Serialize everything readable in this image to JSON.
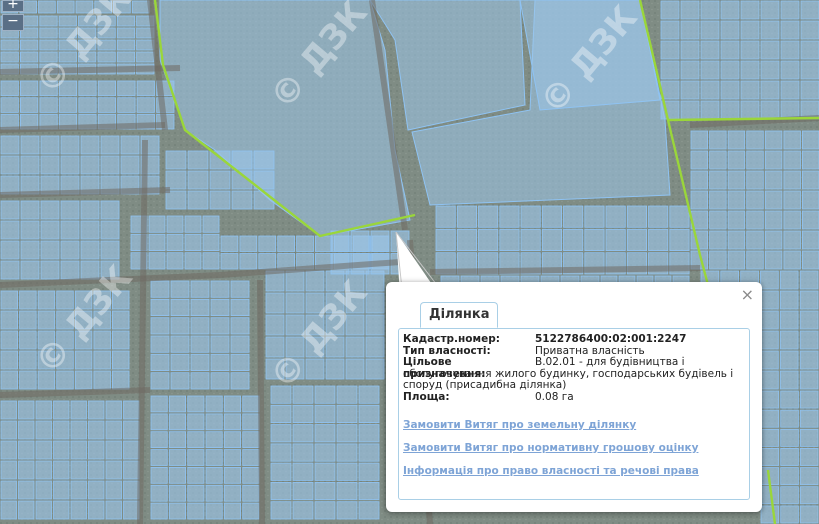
{
  "zoom": {
    "in_label": "+",
    "out_label": "−"
  },
  "watermark": {
    "text": "© ДЗК"
  },
  "colors": {
    "parcel_fill": "#9cc7ea",
    "parcel_stroke": "#8fc3f3",
    "boundary": "#9ad63a",
    "link": "#7ea4d6"
  },
  "popup": {
    "close_label": "×",
    "tab_label": "Ділянка",
    "fields": [
      {
        "label": "Кадастр.номер:",
        "value": "5122786400:02:001:2247"
      },
      {
        "label": "Тип власності:",
        "value": "Приватна власність"
      },
      {
        "label": "Цільове призначення:",
        "value": "В.02.01 - для будівництва і обслуговування жилого будинку, господарських будівель і споруд (присадибна ділянка)"
      },
      {
        "label": "Площа:",
        "value": "0.08 га"
      }
    ],
    "links": [
      "Замовити Витяг про земельну ділянку",
      "Замовити Витяг про нормативну грошову оцінку",
      "Інформація про право власності та речові права"
    ]
  }
}
